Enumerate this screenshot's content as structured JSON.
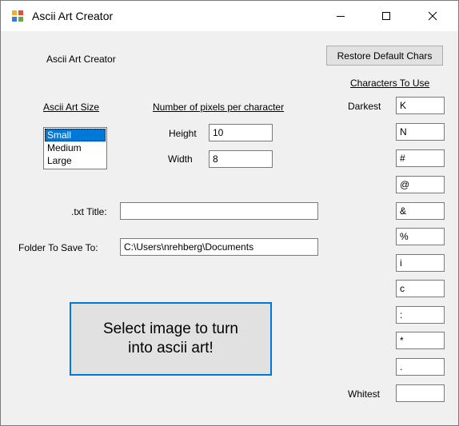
{
  "window": {
    "title": "Ascii Art Creator",
    "icon": "app-icon",
    "controls": [
      "minimize-icon",
      "maximize-icon",
      "close-icon"
    ]
  },
  "form": {
    "heading": "Ascii Art Creator",
    "restore_button": "Restore Default Chars",
    "size_section": {
      "label": "Ascii Art Size",
      "options": [
        "Small",
        "Medium",
        "Large"
      ],
      "selected": "Small"
    },
    "pixels_section": {
      "label": "Number of pixels per character",
      "height_label": "Height",
      "height_value": "10",
      "width_label": "Width",
      "width_value": "8"
    },
    "txt_title": {
      "label": ".txt Title:",
      "value": ""
    },
    "folder": {
      "label": "Folder To Save To:",
      "value": "C:\\Users\\nrehberg\\Documents"
    },
    "select_button": "Select image to turn into ascii art!",
    "characters": {
      "label": "Characters To Use",
      "darkest_label": "Darkest",
      "whitest_label": "Whitest",
      "values": [
        "K",
        "N",
        "#",
        "@",
        "&",
        "%",
        "i",
        "c",
        ":",
        "*",
        ".",
        ""
      ]
    }
  },
  "colors": {
    "selection": "#0078d7",
    "window_bg": "#f0f0f0",
    "button_bg": "#e1e1e1"
  }
}
